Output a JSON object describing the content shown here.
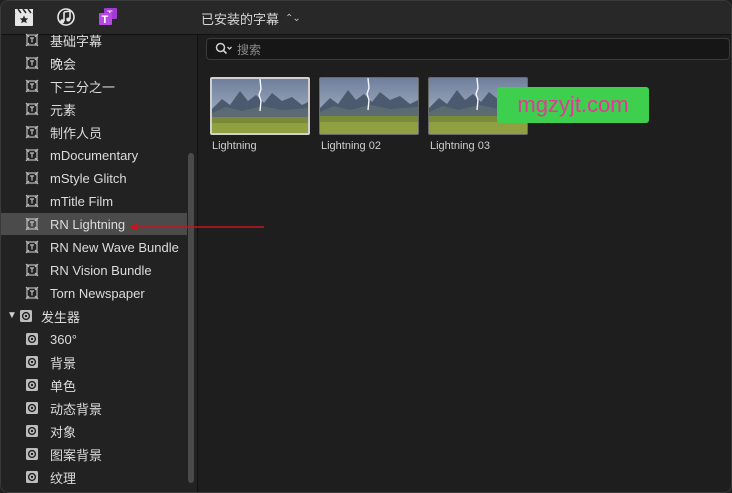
{
  "topbar": {
    "icons": [
      "clapper-star-icon",
      "music-photo-icon",
      "titles-icon"
    ],
    "browser_title": "已安装的字幕",
    "title_menu_glyph": "⌃⌄"
  },
  "sidebar": {
    "items": [
      {
        "label": "基础字幕",
        "kind": "title"
      },
      {
        "label": "晚会",
        "kind": "title"
      },
      {
        "label": "下三分之一",
        "kind": "title"
      },
      {
        "label": "元素",
        "kind": "title"
      },
      {
        "label": "制作人员",
        "kind": "title"
      },
      {
        "label": "mDocumentary",
        "kind": "title"
      },
      {
        "label": "mStyle Glitch",
        "kind": "title"
      },
      {
        "label": "mTitle Film",
        "kind": "title"
      },
      {
        "label": "RN Lightning",
        "kind": "title",
        "selected": true
      },
      {
        "label": "RN New Wave Bundle",
        "kind": "title"
      },
      {
        "label": "RN Vision Bundle",
        "kind": "title"
      },
      {
        "label": "Torn Newspaper",
        "kind": "title"
      },
      {
        "label": "发生器",
        "kind": "group",
        "expanded": true
      },
      {
        "label": "360°",
        "kind": "generator"
      },
      {
        "label": "背景",
        "kind": "generator"
      },
      {
        "label": "单色",
        "kind": "generator"
      },
      {
        "label": "动态背景",
        "kind": "generator"
      },
      {
        "label": "对象",
        "kind": "generator"
      },
      {
        "label": "图案背景",
        "kind": "generator"
      },
      {
        "label": "纹理",
        "kind": "generator"
      }
    ]
  },
  "search": {
    "placeholder": "搜索"
  },
  "clips": [
    {
      "label": "Lightning",
      "selected": true
    },
    {
      "label": "Lightning 02",
      "selected": false
    },
    {
      "label": "Lightning 03",
      "selected": false
    }
  ],
  "watermark": {
    "text": "mgzyjt.com"
  },
  "colors": {
    "selection": "#4b4b4b",
    "arrow": "#c0181f",
    "watermark_bg": "#3fcf4f",
    "watermark_text": "#e8359a"
  }
}
